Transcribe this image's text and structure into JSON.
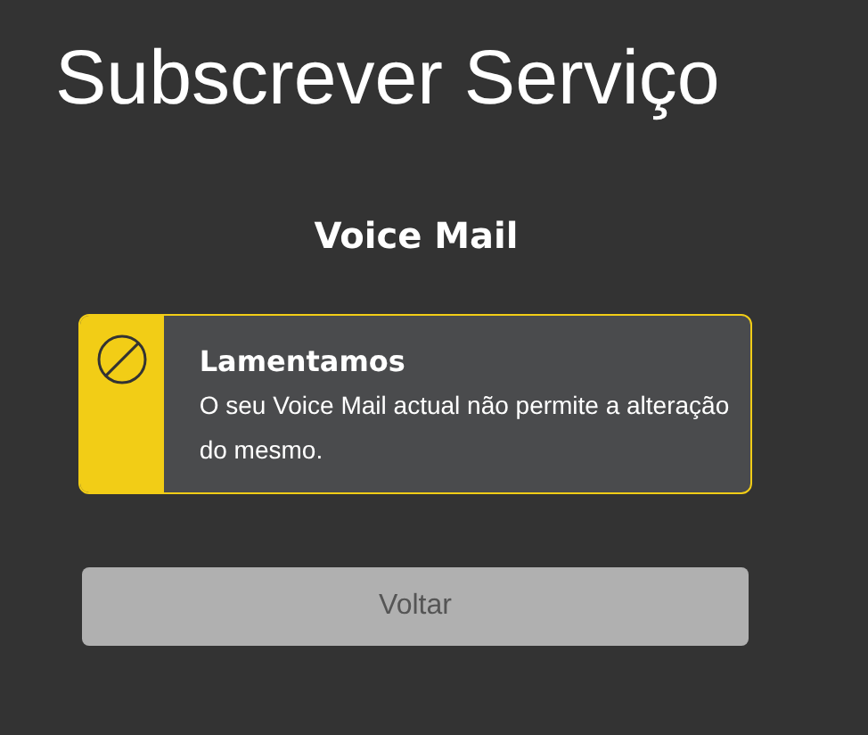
{
  "page": {
    "title": "Subscrever Serviço"
  },
  "section": {
    "title": "Voice Mail"
  },
  "alert": {
    "kind": "error",
    "title": "Lamentamos",
    "message": "O seu Voice Mail actual não permite a alteração do mesmo."
  },
  "buttons": [
    {
      "label": "Voltar"
    }
  ]
}
